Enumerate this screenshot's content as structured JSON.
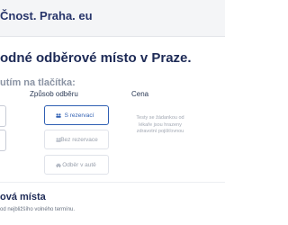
{
  "header": {
    "site_name": "Čnost. Praha. eu"
  },
  "main": {
    "title": "odné odběrové místo v Praze.",
    "section_heading": "utím na tlačítka:",
    "column_method": "Způsob odběru",
    "column_price": "Cena",
    "methods": [
      {
        "label": "S rezervací",
        "selected": true
      },
      {
        "label": "Bez rezervace",
        "selected": false
      },
      {
        "label": "Odběr v autě",
        "selected": false
      }
    ],
    "price_note": "Testy se žádankou od lékaře jsou hrazeny zdravotní pojišťovnou",
    "colors": {
      "accent": "#2f5fb3",
      "title": "#1d2a56",
      "muted": "#9aa1ad"
    }
  },
  "bottom": {
    "heading": "ová místa",
    "subtext": "od nejbližšího volného termínu."
  }
}
